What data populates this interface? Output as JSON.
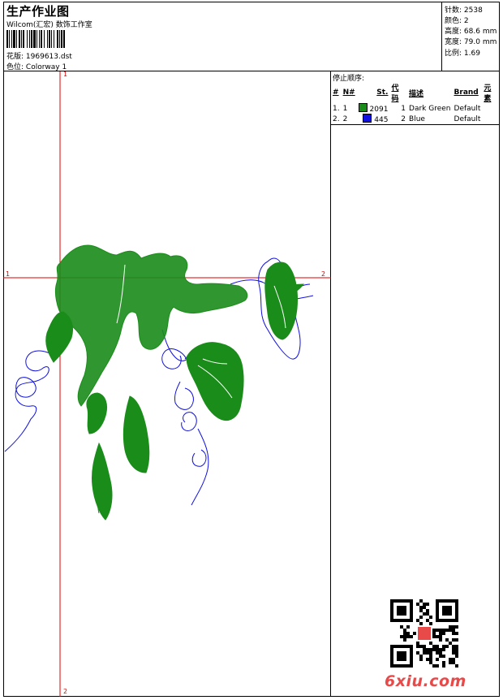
{
  "header": {
    "title": "生产作业图",
    "subtitle": "Wilcom(汇宏) 数饰工作室",
    "design_file_label": "花版:",
    "design_file": "1969613.dst",
    "colorway_label": "色位:",
    "colorway": "Colorway 1"
  },
  "stats": {
    "stitches_label": "针数:",
    "stitches": "2538",
    "colors_label": "颜色:",
    "colors": "2",
    "height_label": "高度:",
    "height": "68.6 mm",
    "width_label": "宽度:",
    "width": "79.0 mm",
    "scale_label": "比例:",
    "scale": "1.69"
  },
  "stop_sequence": {
    "title": "停止顺序:",
    "columns": [
      "#",
      "N#",
      "St.",
      "代码",
      "描述",
      "Brand",
      "元素"
    ],
    "rows": [
      {
        "idx": "1.",
        "n": "1",
        "color": "#1a8c1a",
        "st": "2091",
        "code": "1",
        "desc": "Dark Green",
        "brand": "Default"
      },
      {
        "idx": "2.",
        "n": "2",
        "color": "#1010e0",
        "st": "445",
        "code": "2",
        "desc": "Blue",
        "brand": "Default"
      }
    ]
  },
  "axes": {
    "v_top": "1",
    "v_bottom": "2",
    "h_left": "1",
    "h_right": "2"
  },
  "watermark": {
    "text": "6xiu.com"
  },
  "colors": {
    "thread_green": "#1a8c1a",
    "thread_blue": "#1010e0",
    "axis_red": "#e00000"
  }
}
